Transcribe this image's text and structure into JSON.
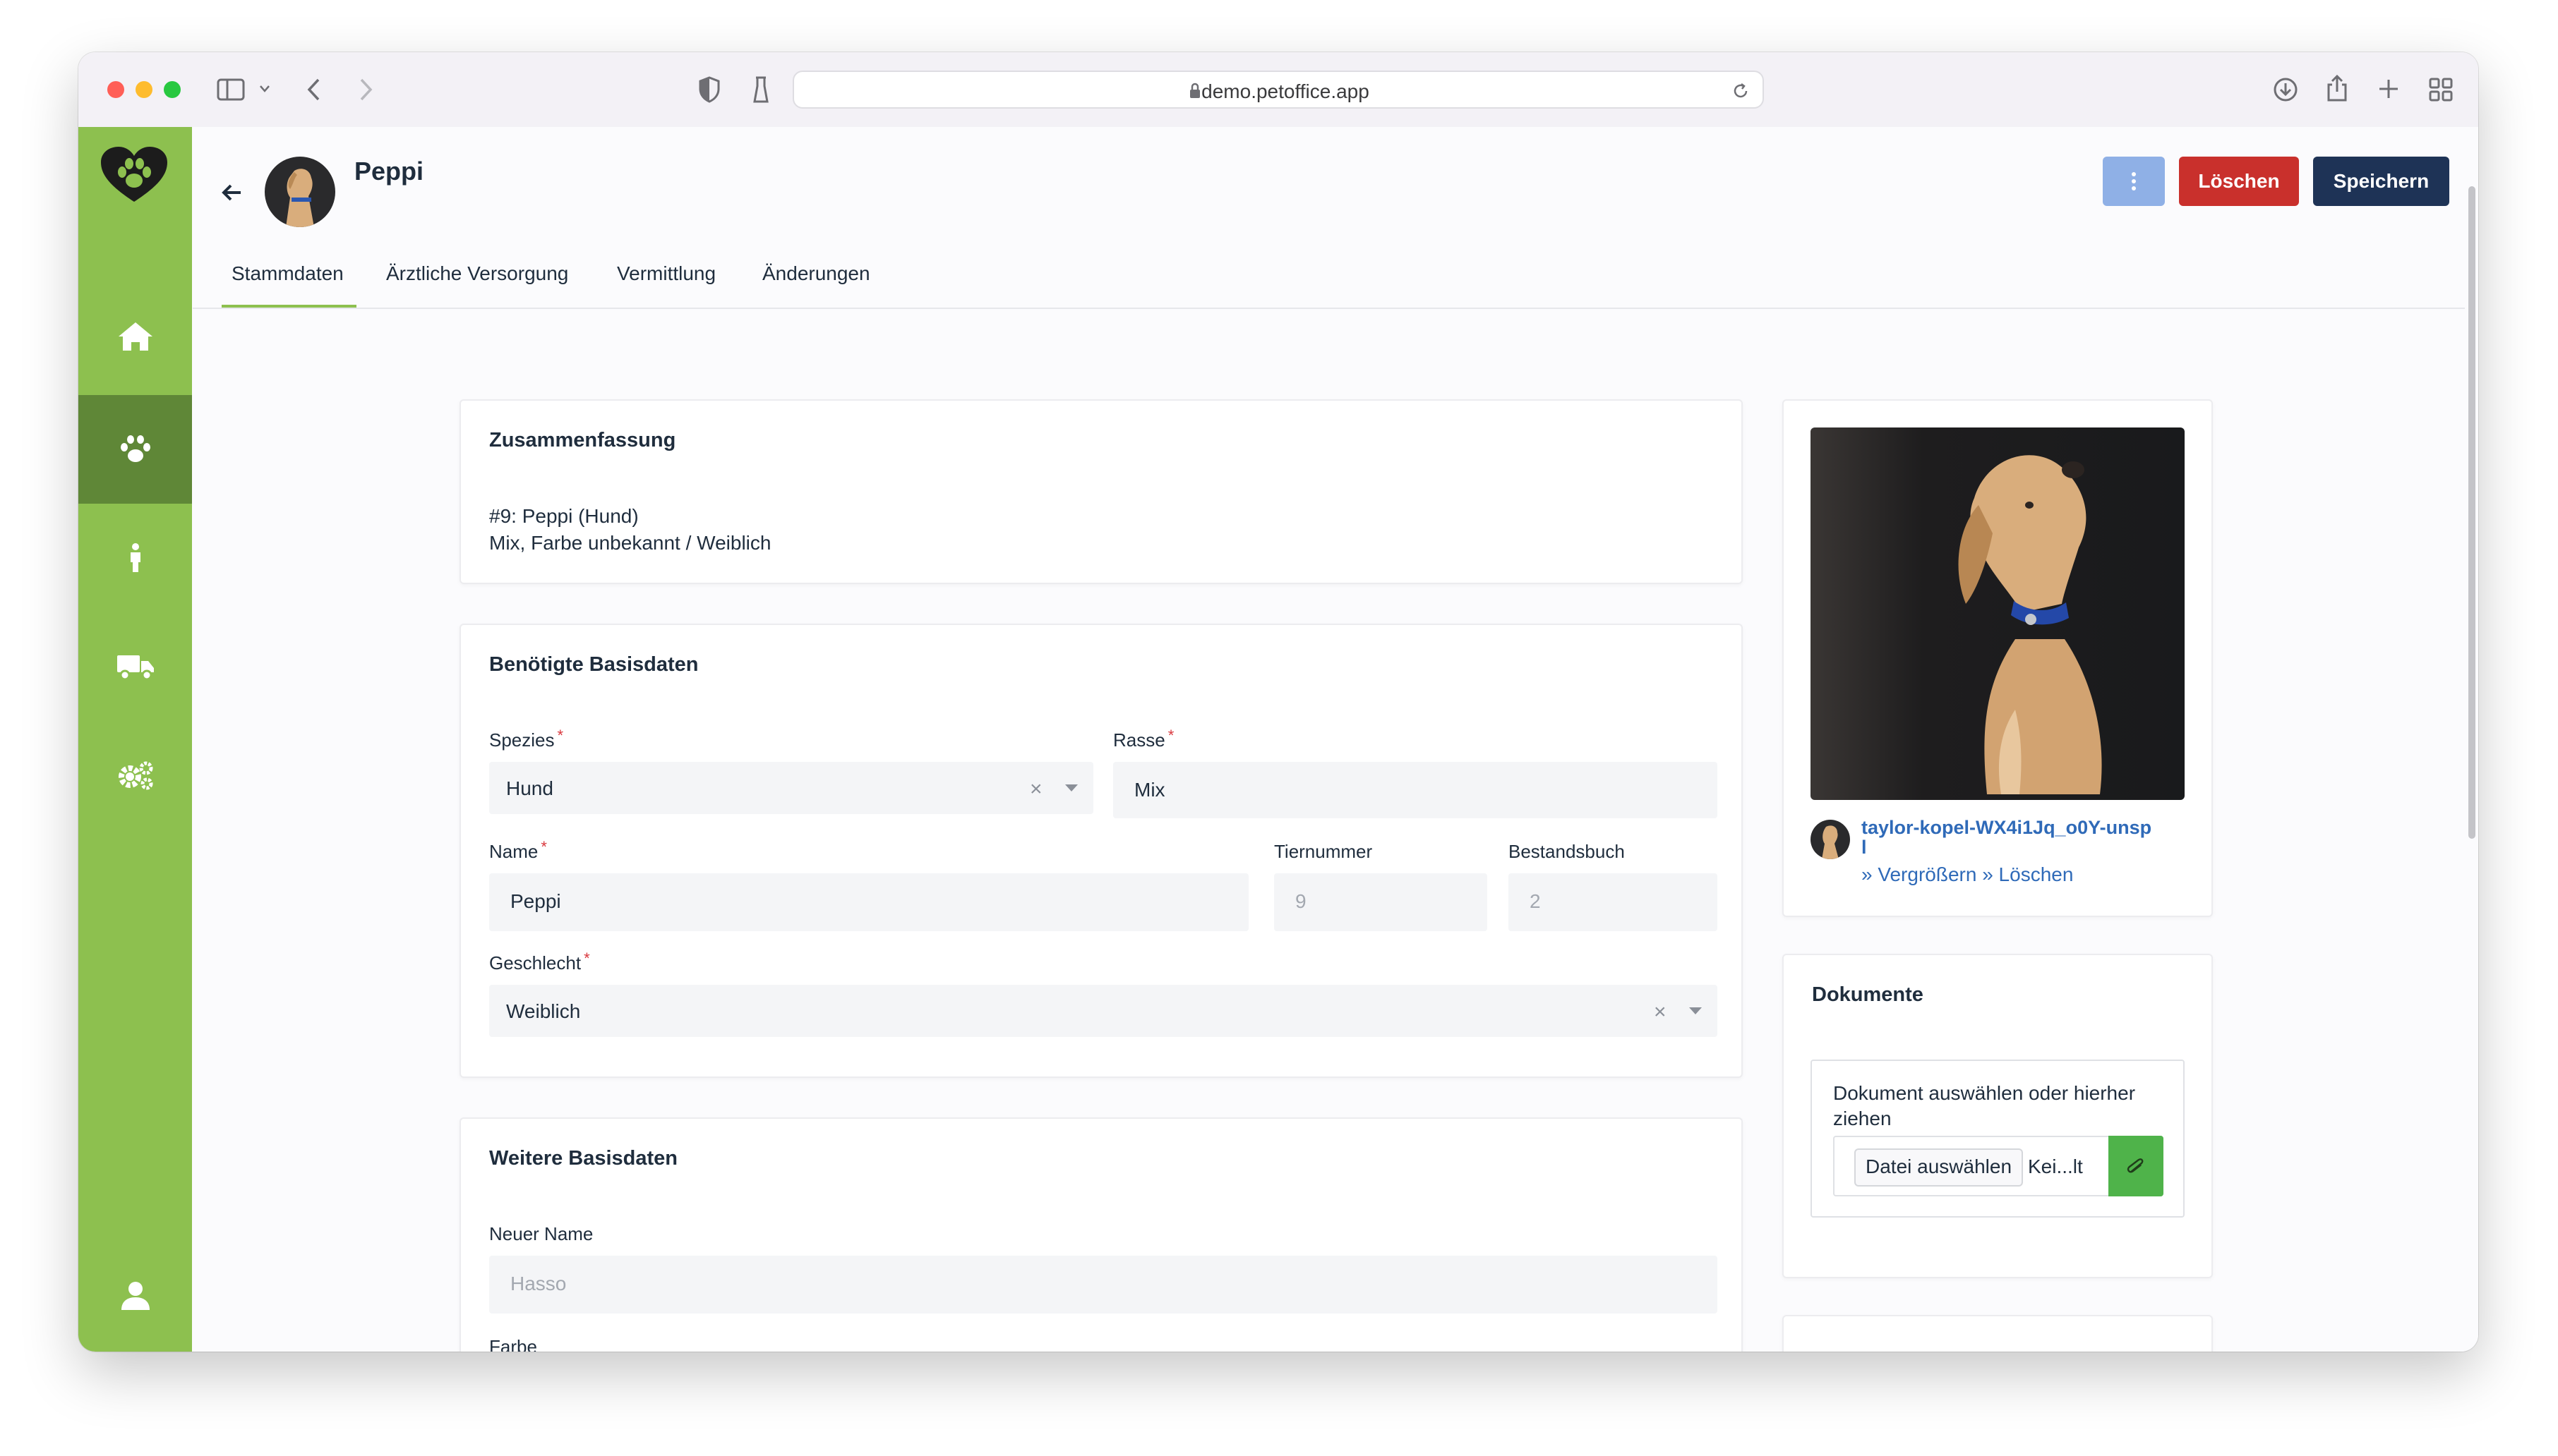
{
  "browser": {
    "url": "demo.petoffice.app"
  },
  "header": {
    "animal_name": "Peppi",
    "delete_label": "Löschen",
    "save_label": "Speichern"
  },
  "tabs": [
    {
      "label": "Stammdaten",
      "active": true
    },
    {
      "label": "Ärztliche Versorgung",
      "active": false
    },
    {
      "label": "Vermittlung",
      "active": false
    },
    {
      "label": "Änderungen",
      "active": false
    }
  ],
  "summary": {
    "title": "Zusammenfassung",
    "line1": "#9: Peppi (Hund)",
    "line2": "Mix, Farbe unbekannt / Weiblich"
  },
  "basic": {
    "title": "Benötigte Basisdaten",
    "species_label": "Spezies",
    "species_value": "Hund",
    "breed_label": "Rasse",
    "breed_value": "Mix",
    "name_label": "Name",
    "name_value": "Peppi",
    "number_label": "Tiernummer",
    "number_value": "9",
    "book_label": "Bestandsbuch",
    "book_value": "2",
    "gender_label": "Geschlecht",
    "gender_value": "Weiblich",
    "required_mark": "*"
  },
  "further": {
    "title": "Weitere Basisdaten",
    "new_name_label": "Neuer Name",
    "new_name_placeholder": "Hasso",
    "color_label": "Farbe"
  },
  "photo": {
    "filename_line1": "taylor-kopel-WX4i1Jq_o0Y-unsp",
    "filename_line2": "l",
    "enlarge_link": "» Vergrößern",
    "delete_link": "» Löschen"
  },
  "documents": {
    "title": "Dokumente",
    "drop_text_1": "Dokument auswählen oder hierher",
    "drop_text_2": "ziehen",
    "choose_file": "Datei auswählen",
    "no_file": "Kei...lt"
  },
  "colors": {
    "sidebar": "#8dc04f",
    "sidebar_active": "#5f8737",
    "delete": "#c9302c",
    "save": "#1e3356",
    "more": "#8fb0e6",
    "attach": "#4fb34a"
  }
}
